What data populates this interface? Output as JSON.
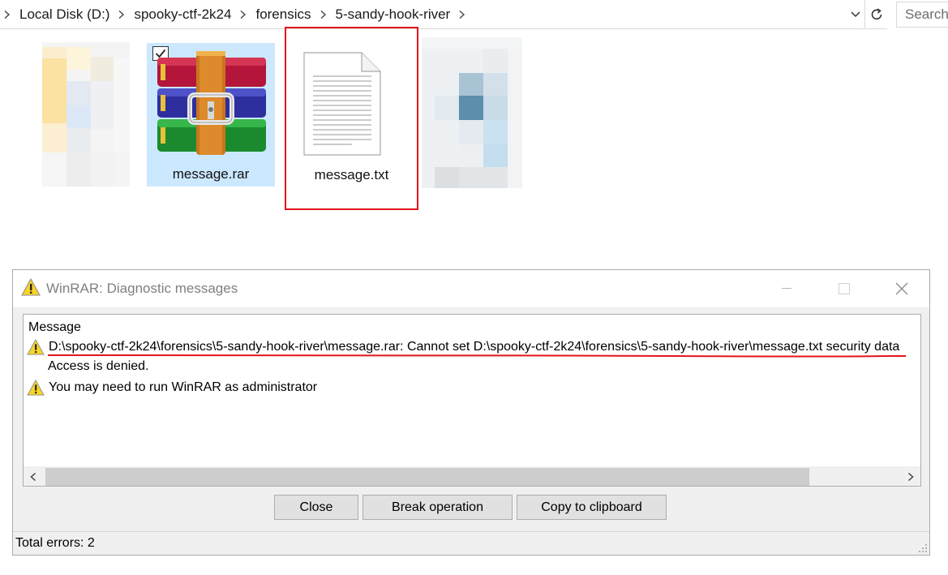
{
  "explorer": {
    "breadcrumbs": [
      "Local Disk (D:)",
      "spooky-ctf-2k24",
      "forensics",
      "5-sandy-hook-river"
    ],
    "search_placeholder": "Search",
    "files": [
      {
        "name": "message.rar",
        "icon": "winrar-archive-icon",
        "selected": true,
        "checked": true
      },
      {
        "name": "message.txt",
        "icon": "text-document-icon",
        "highlighted": true
      }
    ],
    "highlight_color": "#e3141b"
  },
  "dialog": {
    "title": "WinRAR: Diagnostic messages",
    "column_header": "Message",
    "messages": [
      {
        "icon": "warning-icon",
        "text": "D:\\spooky-ctf-2k24\\forensics\\5-sandy-hook-river\\message.rar: Cannot set D:\\spooky-ctf-2k24\\forensics\\5-sandy-hook-river\\message.txt security data"
      },
      {
        "icon": "",
        "text": "Access is denied."
      },
      {
        "icon": "warning-icon",
        "text": "You may need to run WinRAR as administrator"
      }
    ],
    "buttons": {
      "close": "Close",
      "break": "Break operation",
      "copy": "Copy to clipboard"
    },
    "status": "Total errors: 2"
  }
}
